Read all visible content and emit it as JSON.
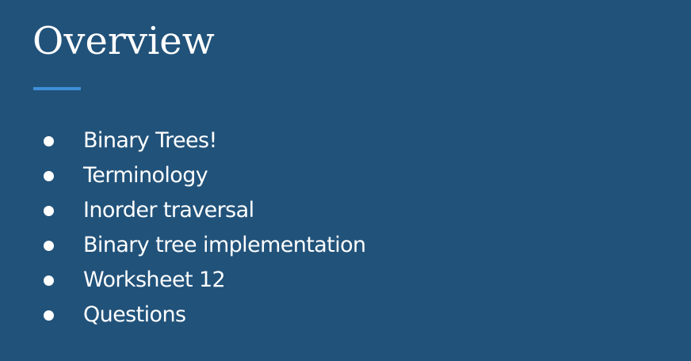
{
  "slide": {
    "title": "Overview",
    "accent_color": "#3d8fd8",
    "background_color": "#21527a",
    "bullets": [
      "Binary Trees!",
      "Terminology",
      "Inorder traversal",
      "Binary tree implementation",
      "Worksheet 12",
      "Questions"
    ]
  }
}
